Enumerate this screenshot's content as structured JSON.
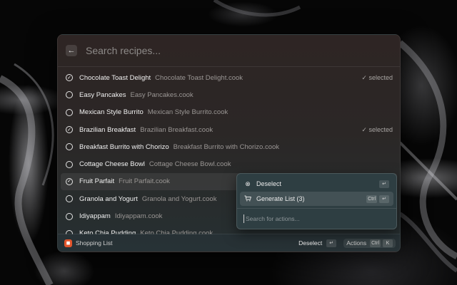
{
  "search": {
    "placeholder": "Search recipes..."
  },
  "recipes": [
    {
      "title": "Chocolate Toast Delight",
      "file": "Chocolate Toast Delight.cook",
      "selected": true,
      "tag": "✓ selected"
    },
    {
      "title": "Easy Pancakes",
      "file": "Easy Pancakes.cook",
      "selected": false
    },
    {
      "title": "Mexican Style Burrito",
      "file": "Mexican Style Burrito.cook",
      "selected": false
    },
    {
      "title": "Brazilian Breakfast",
      "file": "Brazilian Breakfast.cook",
      "selected": true,
      "tag": "✓ selected"
    },
    {
      "title": "Breakfast Burrito with Chorizo",
      "file": "Breakfast Burrito with Chorizo.cook",
      "selected": false
    },
    {
      "title": "Cottage Cheese Bowl",
      "file": "Cottage Cheese Bowl.cook",
      "selected": false
    },
    {
      "title": "Fruit Parfait",
      "file": "Fruit Parfait.cook",
      "selected": true,
      "highlighted": true
    },
    {
      "title": "Granola and Yogurt",
      "file": "Granola and Yogurt.cook",
      "selected": false
    },
    {
      "title": "Idiyappam",
      "file": "Idiyappam.cook",
      "selected": false
    },
    {
      "title": "Keto Chia Pudding",
      "file": "Keto Chia Pudding.cook",
      "selected": false
    }
  ],
  "footer": {
    "app_name": "Shopping List",
    "primary_action": "Deselect",
    "primary_key": "↵",
    "actions_label": "Actions",
    "actions_keys": [
      "Ctrl",
      "K"
    ]
  },
  "action_panel": {
    "items": [
      {
        "icon": "deselect-icon",
        "label": "Deselect",
        "keys": [
          "↵"
        ]
      },
      {
        "icon": "cart-icon",
        "label": "Generate List (3)",
        "keys": [
          "Ctrl",
          "↵"
        ]
      }
    ],
    "search_placeholder": "Search for actions..."
  },
  "colors": {
    "accent": "#e2552c",
    "window_top": "#2e2524",
    "window_bottom": "#263032",
    "panel": "#2e3e42"
  }
}
